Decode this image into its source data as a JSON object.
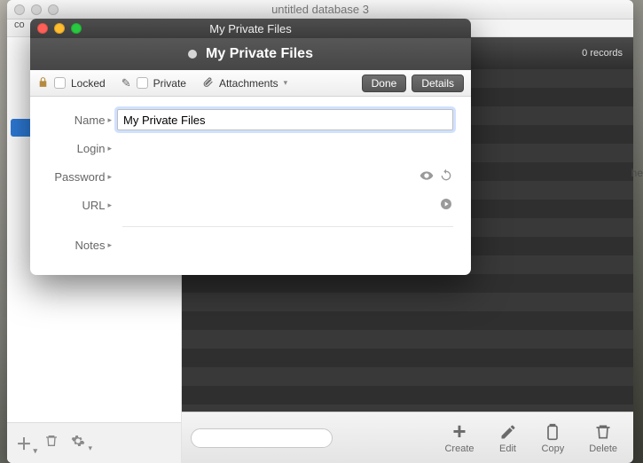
{
  "main": {
    "title": "untitled database 3",
    "records_label": "0 records"
  },
  "bottom": {
    "create": "Create",
    "edit": "Edit",
    "copy": "Copy",
    "delete": "Delete",
    "search_placeholder": ""
  },
  "modal": {
    "titlebar": "My Private Files",
    "heading": "My Private Files",
    "toolbar": {
      "locked": "Locked",
      "private": "Private",
      "attachments": "Attachments",
      "done": "Done",
      "details": "Details"
    },
    "fields": {
      "name_label": "Name",
      "name_value": "My Private Files",
      "login_label": "Login",
      "login_value": "",
      "password_label": "Password",
      "password_value": "",
      "url_label": "URL",
      "url_value": "",
      "notes_label": "Notes",
      "notes_value": ""
    }
  },
  "edge_text": "he"
}
